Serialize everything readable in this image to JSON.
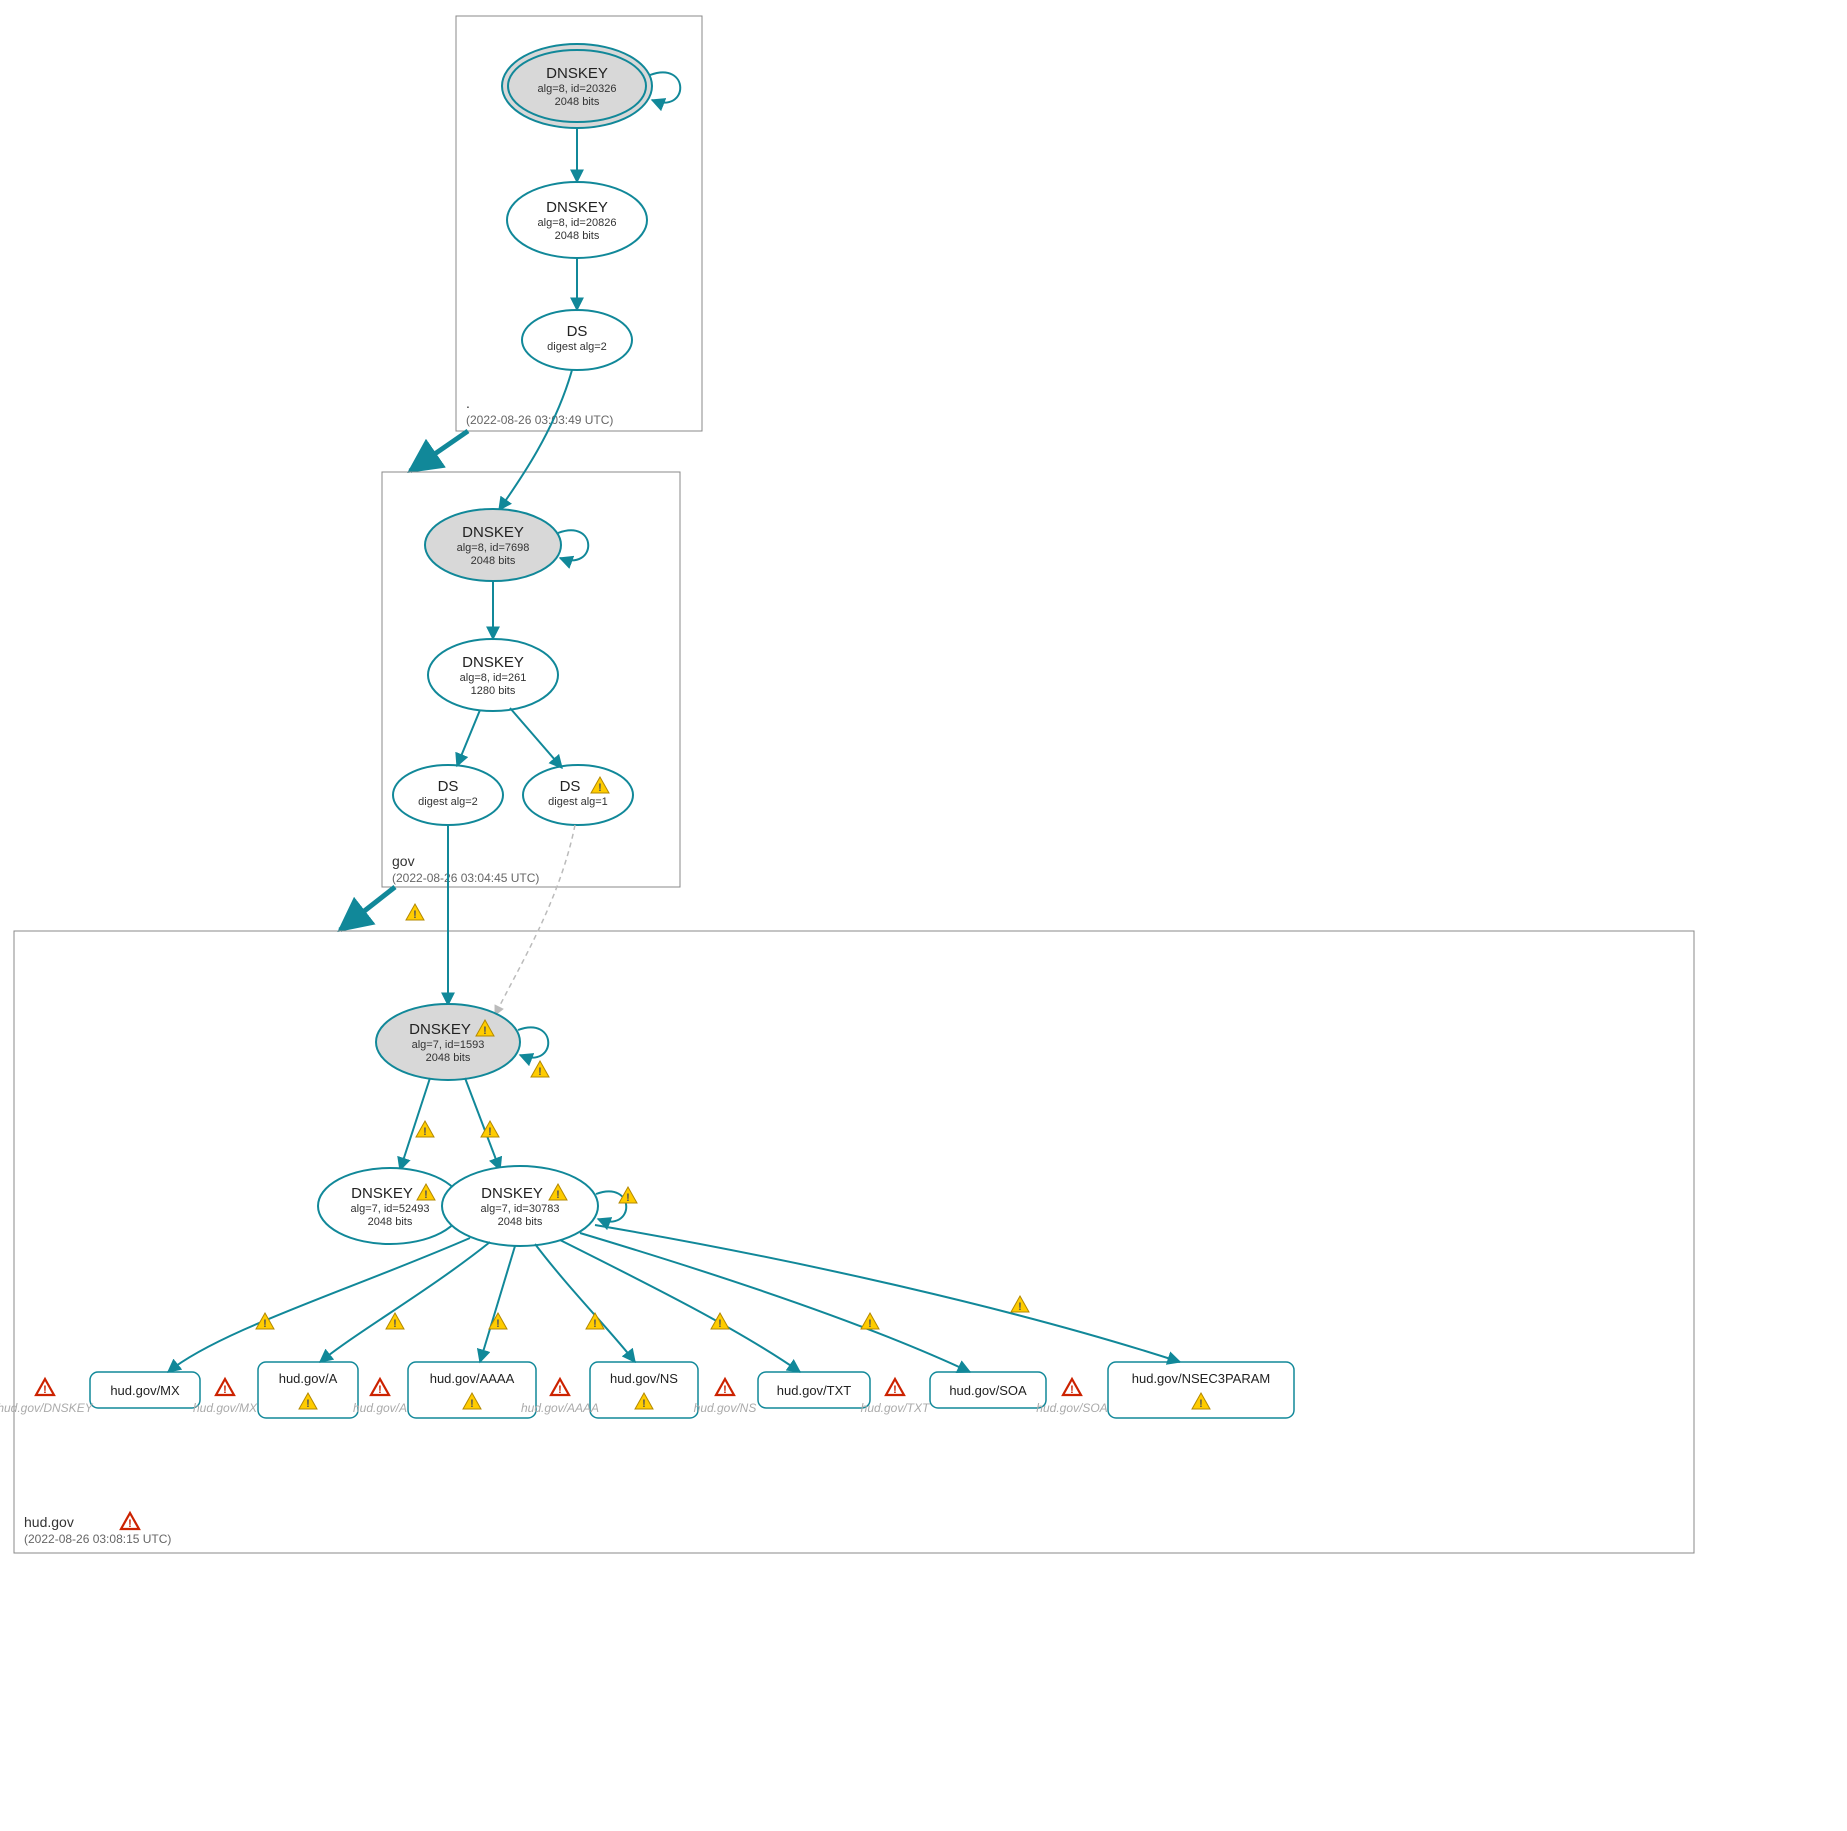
{
  "zones": {
    "root": {
      "label": ".",
      "timestamp": "(2022-08-26 03:03:49 UTC)"
    },
    "gov": {
      "label": "gov",
      "timestamp": "(2022-08-26 03:04:45 UTC)"
    },
    "hud": {
      "label": "hud.gov",
      "timestamp": "(2022-08-26 03:08:15 UTC)"
    }
  },
  "nodes": {
    "root_ksk": {
      "title": "DNSKEY",
      "l2": "alg=8, id=20326",
      "l3": "2048 bits"
    },
    "root_zsk": {
      "title": "DNSKEY",
      "l2": "alg=8, id=20826",
      "l3": "2048 bits"
    },
    "root_ds": {
      "title": "DS",
      "l2": "digest alg=2"
    },
    "gov_ksk": {
      "title": "DNSKEY",
      "l2": "alg=8, id=7698",
      "l3": "2048 bits"
    },
    "gov_zsk": {
      "title": "DNSKEY",
      "l2": "alg=8, id=261",
      "l3": "1280 bits"
    },
    "gov_ds1": {
      "title": "DS",
      "l2": "digest alg=2"
    },
    "gov_ds2": {
      "title": "DS",
      "l2": "digest alg=1"
    },
    "hud_ksk": {
      "title": "DNSKEY",
      "l2": "alg=7, id=1593",
      "l3": "2048 bits"
    },
    "hud_zsk1": {
      "title": "DNSKEY",
      "l2": "alg=7, id=52493",
      "l3": "2048 bits"
    },
    "hud_zsk2": {
      "title": "DNSKEY",
      "l2": "alg=7, id=30783",
      "l3": "2048 bits"
    }
  },
  "records": {
    "mx": "hud.gov/MX",
    "a": "hud.gov/A",
    "aaaa": "hud.gov/AAAA",
    "ns": "hud.gov/NS",
    "txt": "hud.gov/TXT",
    "soa": "hud.gov/SOA",
    "nsec3": "hud.gov/NSEC3PARAM"
  },
  "ghosts": {
    "dnskey": "hud.gov/DNSKEY",
    "mx": "hud.gov/MX",
    "a": "hud.gov/A",
    "aaaa": "hud.gov/AAAA",
    "ns": "hud.gov/NS",
    "txt": "hud.gov/TXT",
    "soa": "hud.gov/SOA"
  }
}
